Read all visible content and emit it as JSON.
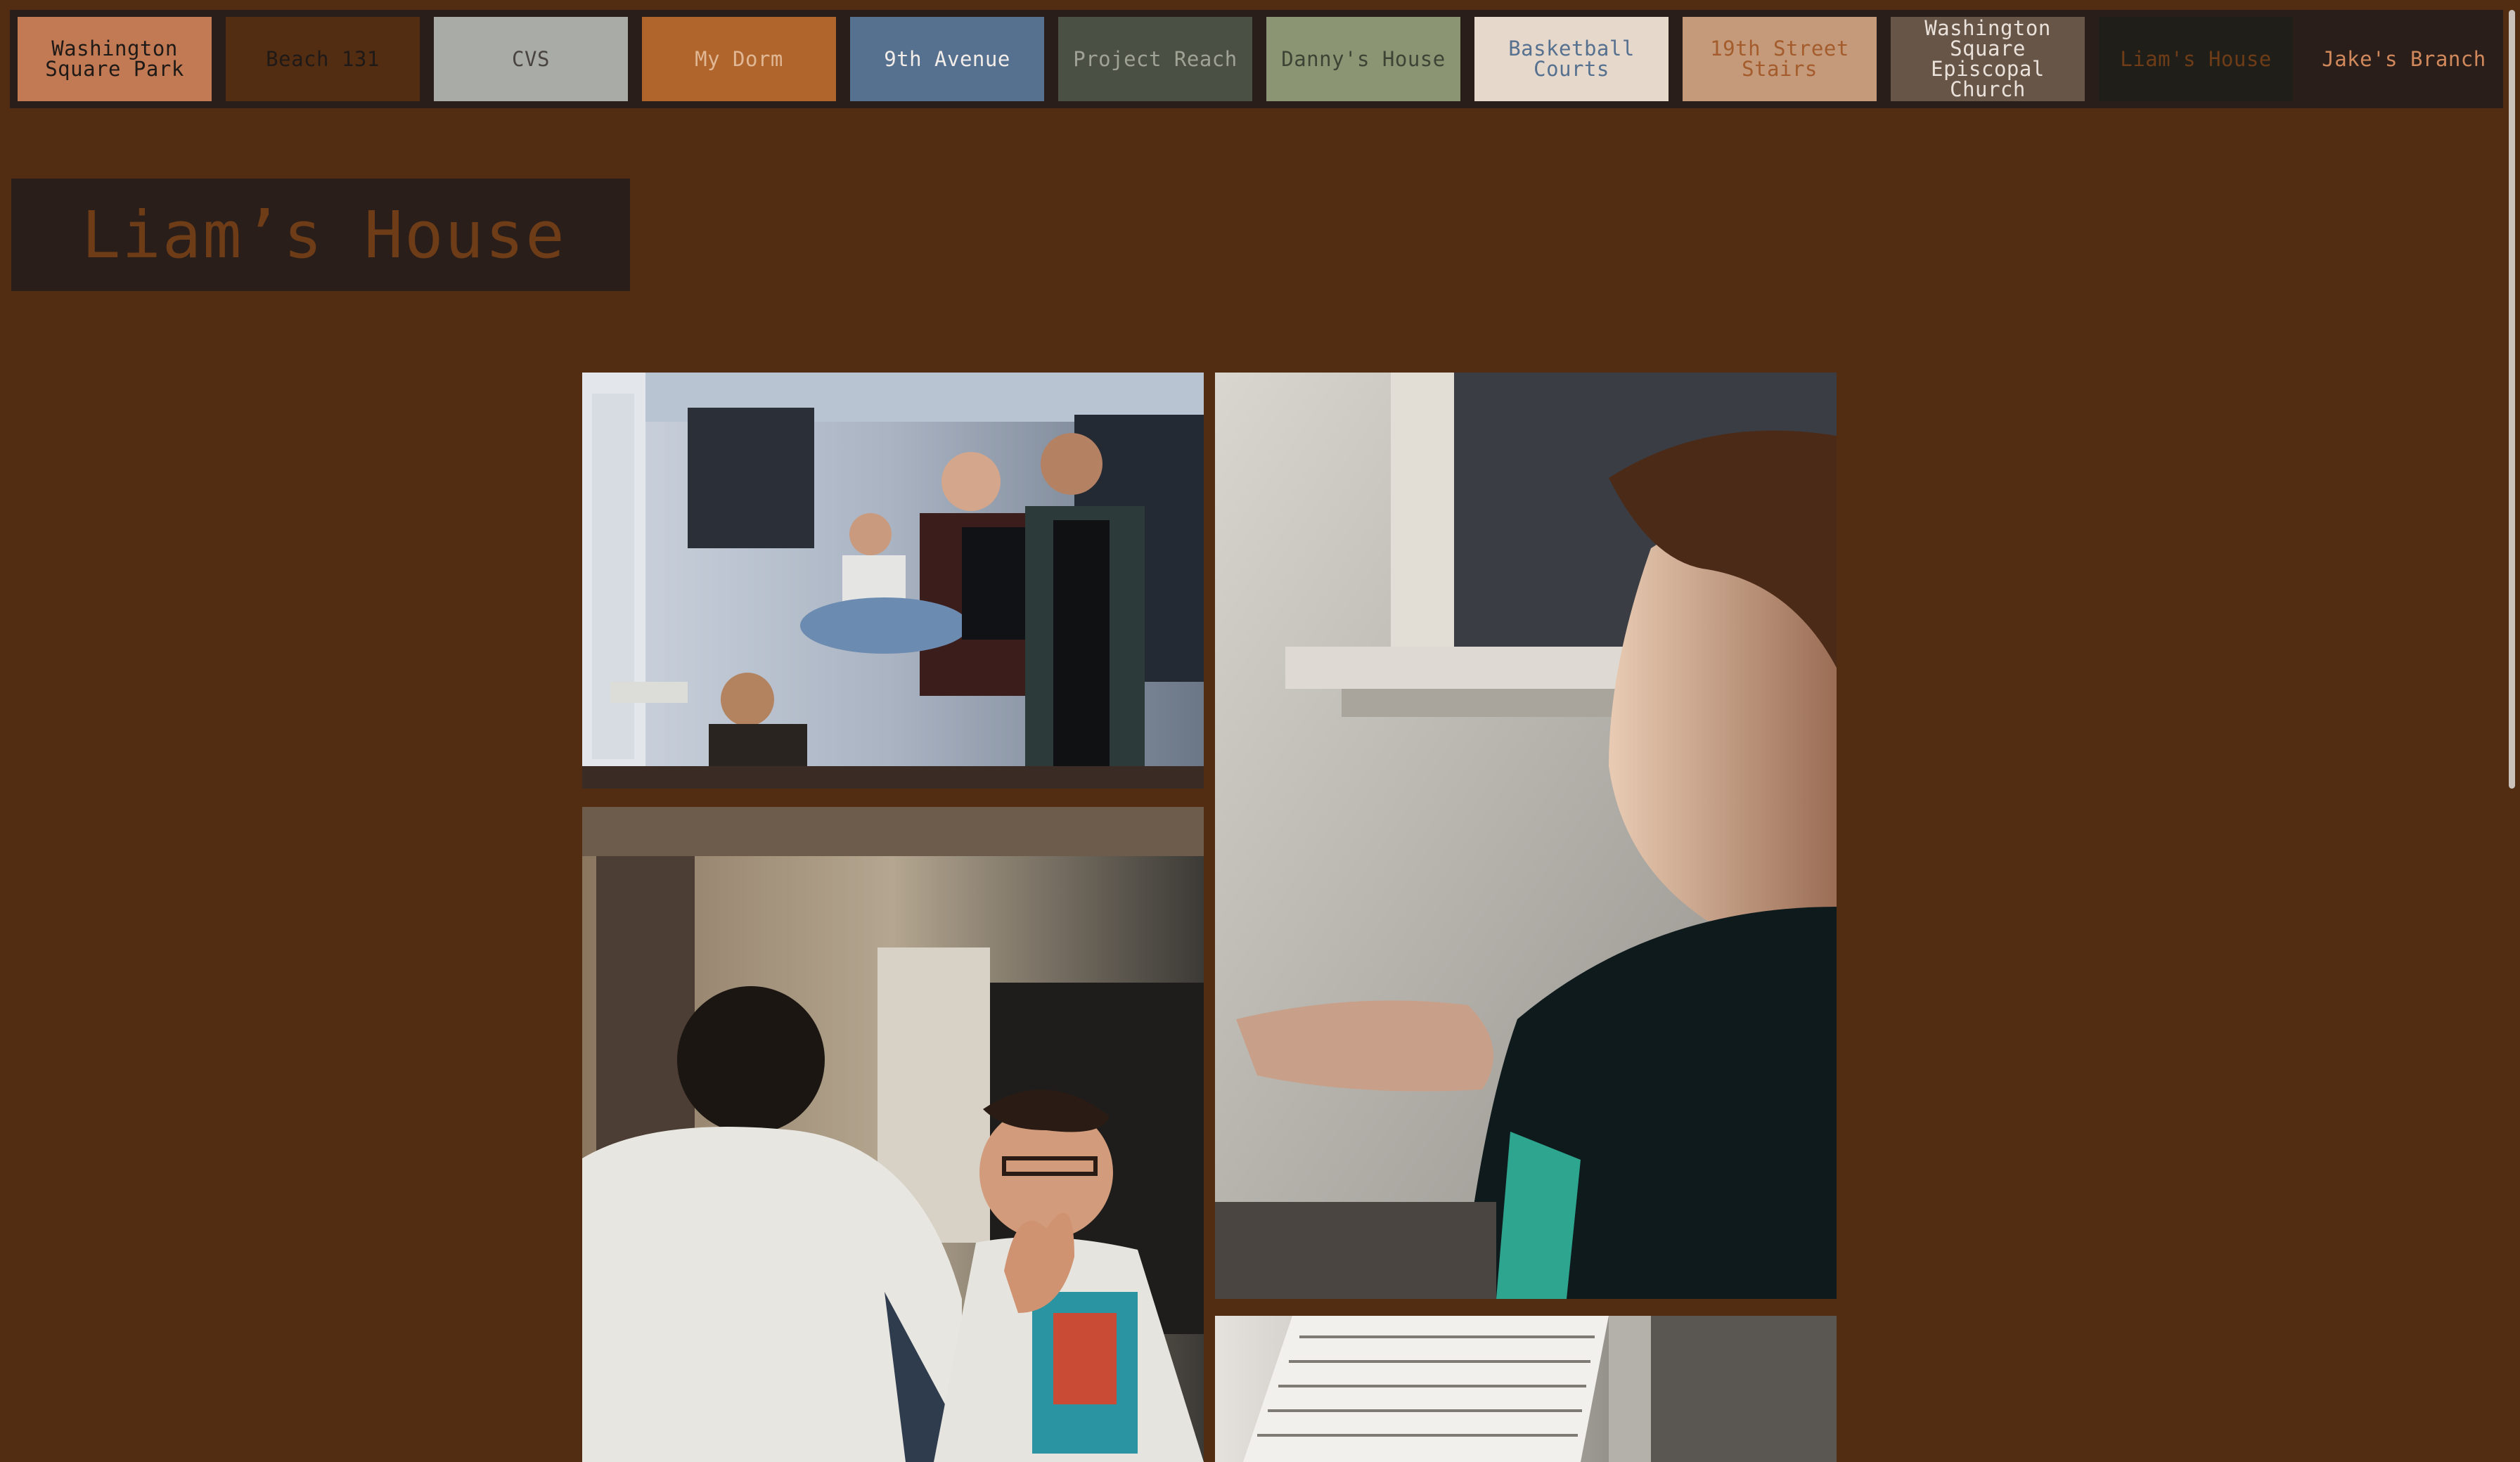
{
  "nav": {
    "items": [
      {
        "label": "Washington Square Park",
        "bg": "#c17a54",
        "fg": "#1f1a17"
      },
      {
        "label": "Beach 131",
        "bg": "#532d12",
        "fg": "#1f1a17"
      },
      {
        "label": "CVS",
        "bg": "#a8aba6",
        "fg": "#4a4440"
      },
      {
        "label": "My Dorm",
        "bg": "#b0652c",
        "fg": "#e0b895"
      },
      {
        "label": "9th Avenue",
        "bg": "#56708f",
        "fg": "#f2ede8"
      },
      {
        "label": "Project Reach",
        "bg": "#4a5043",
        "fg": "#9fa395"
      },
      {
        "label": "Danny's House",
        "bg": "#8c9573",
        "fg": "#3e4435"
      },
      {
        "label": "Basketball Courts",
        "bg": "#e6d9cc",
        "fg": "#56708f"
      },
      {
        "label": "19th Street Stairs",
        "bg": "#c49a7b",
        "fg": "#a45c2c"
      },
      {
        "label": "Washington Square Episcopal Church",
        "bg": "#675648",
        "fg": "#e9e1da"
      },
      {
        "label": "Liam's House",
        "bg": "#201e19",
        "fg": "#6e3c16"
      },
      {
        "label": "Jake's Branch",
        "bg": "#2a1e1a",
        "fg": "#d1895c"
      }
    ]
  },
  "page": {
    "title": "Liam’s House",
    "background": "#532d12"
  },
  "photos": [
    {
      "name": "group-photo"
    },
    {
      "name": "smiling-profile-photo"
    },
    {
      "name": "conversation-photo"
    },
    {
      "name": "ceiling-photo"
    }
  ]
}
